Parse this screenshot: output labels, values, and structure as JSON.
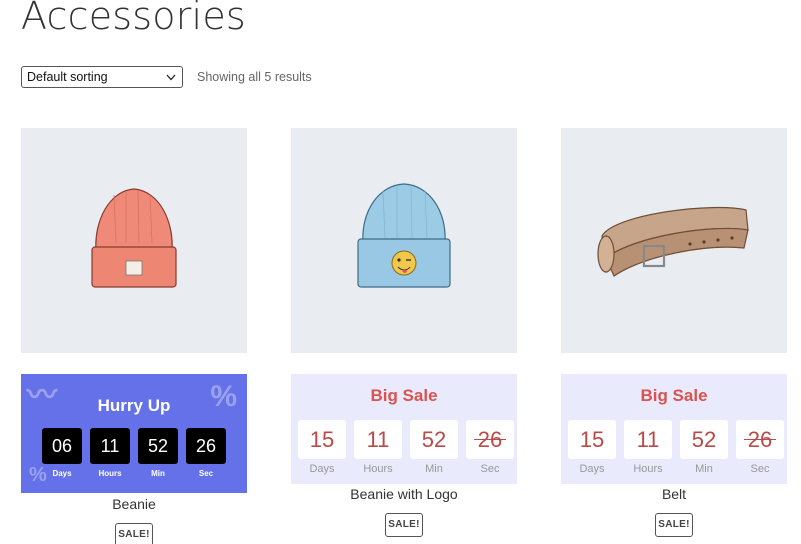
{
  "page": {
    "title": "Accessories"
  },
  "toolbar": {
    "sorting_selected": "Default sorting",
    "results_text": "Showing all 5 results"
  },
  "products": [
    {
      "name": "Beanie",
      "badge": "SALE!",
      "image": "beanie-orange",
      "countdown": {
        "style": "hurry",
        "title": "Hurry Up",
        "days": "06",
        "hours": "11",
        "min": "52",
        "sec": "26",
        "labels": {
          "days": "Days",
          "hours": "Hours",
          "min": "Min",
          "sec": "Sec"
        },
        "background": "#6571e8"
      }
    },
    {
      "name": "Beanie with Logo",
      "badge": "SALE!",
      "image": "beanie-blue-logo",
      "countdown": {
        "style": "sale",
        "title": "Big Sale",
        "days": "15",
        "hours": "11",
        "min": "52",
        "sec": "26",
        "labels": {
          "days": "Days",
          "hours": "Hours",
          "min": "Min",
          "sec": "Sec"
        },
        "background": "#e9ebfd"
      }
    },
    {
      "name": "Belt",
      "badge": "SALE!",
      "image": "belt",
      "countdown": {
        "style": "sale",
        "title": "Big Sale",
        "days": "15",
        "hours": "11",
        "min": "52",
        "sec": "26",
        "labels": {
          "days": "Days",
          "hours": "Hours",
          "min": "Min",
          "sec": "Sec"
        },
        "background": "#e9ebfd"
      }
    }
  ],
  "colors": {
    "sale_red": "#d9534f",
    "hurry_blue": "#6571e8",
    "thumb_bg": "#e9ecf0"
  }
}
